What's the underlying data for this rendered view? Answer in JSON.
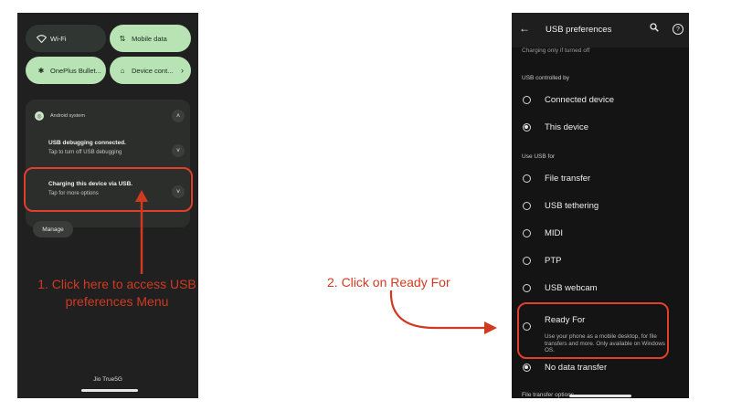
{
  "left_phone": {
    "tiles": {
      "wifi": "Wi-Fi",
      "mobile_data": "Mobile data",
      "bluetooth": "OnePlus Bullet...",
      "device_controls": "Device cont..."
    },
    "notification": {
      "app_name": "Android system",
      "items": [
        {
          "title": "USB debugging connected.",
          "subtitle": "Tap to turn off USB debugging"
        },
        {
          "title": "Charging this device via USB.",
          "subtitle": "Tap for more options"
        }
      ]
    },
    "manage_label": "Manage",
    "carrier": "Jio True5G"
  },
  "annotations": {
    "step1": "1. Click here to access USB preferences Menu",
    "step2": "2. Click on Ready For",
    "highlight_color": "#e0402a"
  },
  "right_phone": {
    "title": "USB preferences",
    "top_note": "Charging only if turned off",
    "section_controlled": "USB controlled by",
    "controlled_options": [
      {
        "label": "Connected device",
        "selected": false
      },
      {
        "label": "This device",
        "selected": true
      }
    ],
    "section_use": "Use USB for",
    "use_options": [
      {
        "label": "File transfer",
        "selected": false
      },
      {
        "label": "USB tethering",
        "selected": false
      },
      {
        "label": "MIDI",
        "selected": false
      },
      {
        "label": "PTP",
        "selected": false
      },
      {
        "label": "USB webcam",
        "selected": false
      },
      {
        "label": "Ready For",
        "selected": false
      },
      {
        "label": "No data transfer",
        "selected": true
      }
    ],
    "ready_for_desc": "Use your phone as a mobile desktop, for file transfers and more. Only available on Windows OS.",
    "bottom_section": "File transfer options"
  },
  "icons": [
    "wifi-icon",
    "mobile-data-icon",
    "bluetooth-icon",
    "home-icon",
    "chevron-right-icon",
    "android-system-icon",
    "chevron-up-icon",
    "chevron-down-icon",
    "back-arrow-icon",
    "search-icon",
    "help-icon",
    "radio-icon"
  ]
}
